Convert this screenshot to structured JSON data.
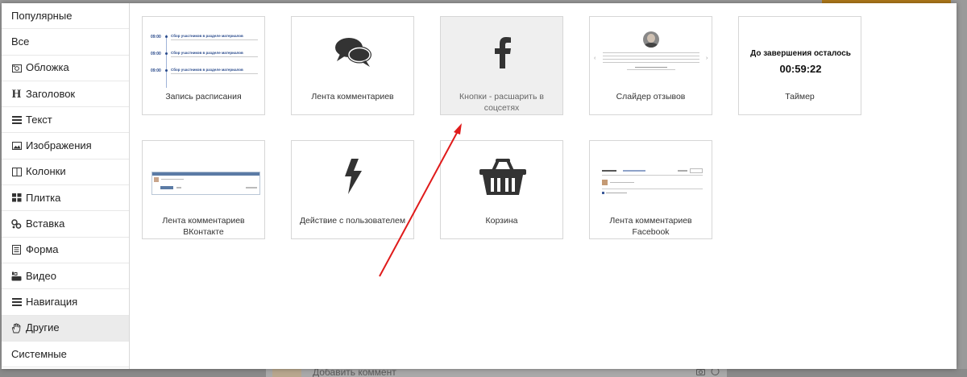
{
  "background": {
    "comment_placeholder": "Добавить коммент"
  },
  "sidebar": {
    "items": [
      {
        "label": "Популярные",
        "icon": ""
      },
      {
        "label": "Все",
        "icon": ""
      },
      {
        "label": "Обложка",
        "icon": "camera-icon"
      },
      {
        "label": "Заголовок",
        "icon": "heading-icon"
      },
      {
        "label": "Текст",
        "icon": "text-lines-icon"
      },
      {
        "label": "Изображения",
        "icon": "image-icon"
      },
      {
        "label": "Колонки",
        "icon": "columns-icon"
      },
      {
        "label": "Плитка",
        "icon": "tiles-icon"
      },
      {
        "label": "Вставка",
        "icon": "code-icon"
      },
      {
        "label": "Форма",
        "icon": "form-icon"
      },
      {
        "label": "Видео",
        "icon": "youtube-icon"
      },
      {
        "label": "Навигация",
        "icon": "menu-icon"
      },
      {
        "label": "Другие",
        "icon": "hand-icon"
      },
      {
        "label": "Системные",
        "icon": ""
      }
    ],
    "heading_letter": "H",
    "active_index": 12
  },
  "blocks": [
    {
      "label": "Запись расписания",
      "preview": "schedule"
    },
    {
      "label": "Лента комментариев",
      "preview": "comments-icon"
    },
    {
      "label": "Кнопки - расшарить в соцсетях",
      "preview": "facebook-icon"
    },
    {
      "label": "Слайдер отзывов",
      "preview": "slider"
    },
    {
      "label": "Таймер",
      "preview": "timer"
    },
    {
      "label": "Лента комментариев ВКонтакте",
      "preview": "vk"
    },
    {
      "label": "Действие с пользователем",
      "preview": "lightning-icon"
    },
    {
      "label": "Корзина",
      "preview": "basket-icon"
    },
    {
      "label": "Лента комментариев Facebook",
      "preview": "facebook-comments"
    }
  ],
  "schedule_preview": {
    "time": "09:00",
    "title": "Сбор участников в разделе материалов"
  },
  "timer_preview": {
    "title": "До завершения осталось",
    "value": "00:59:22"
  },
  "colors": {
    "arrow": "#e01b1b",
    "schedule_accent": "#2a4b8c",
    "vk_header": "#5b7ba5"
  }
}
